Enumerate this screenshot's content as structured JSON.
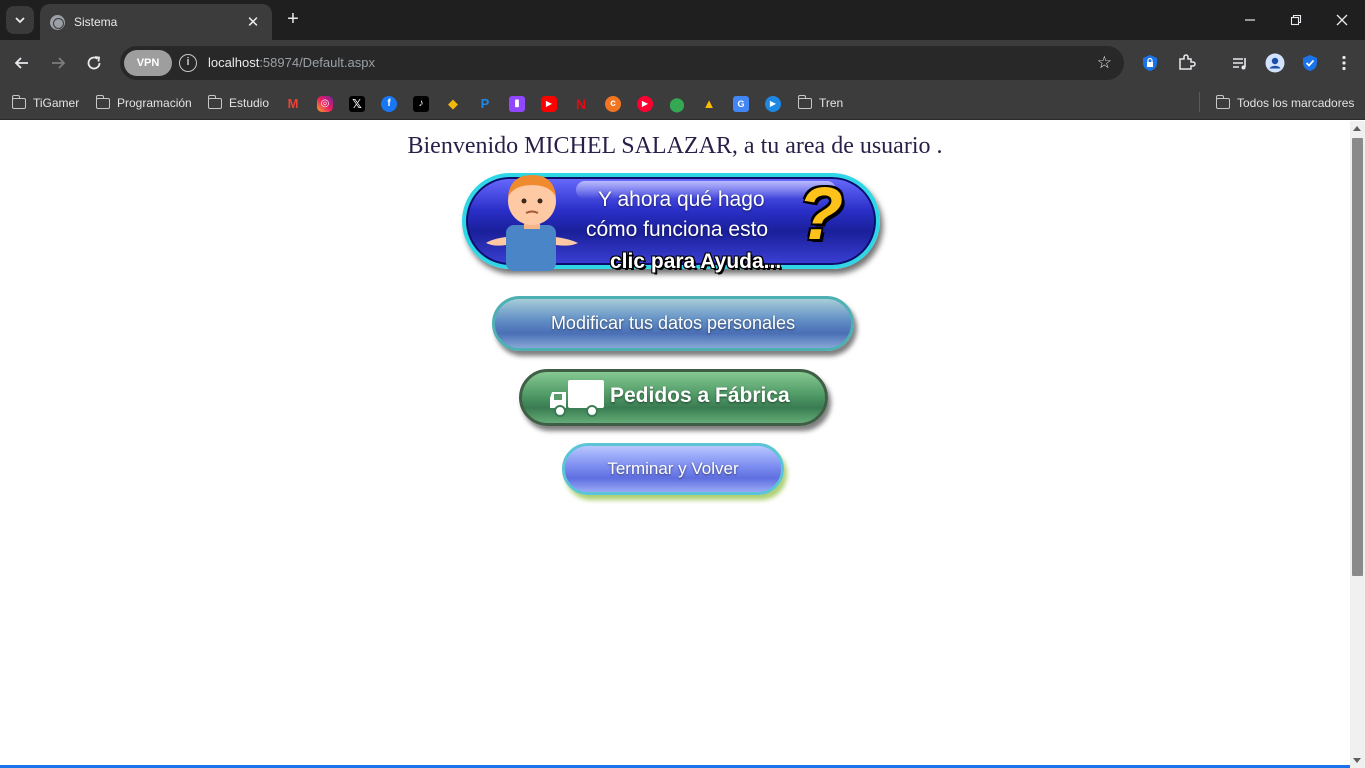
{
  "browser": {
    "tab_title": "Sistema",
    "url_host": "localhost",
    "url_rest": ":58974/Default.aspx",
    "vpn_label": "VPN"
  },
  "bookmarks": {
    "folders": [
      "TiGamer",
      "Programación",
      "Estudio",
      "Tren"
    ],
    "all_bookmarks": "Todos los marcadores"
  },
  "page": {
    "welcome": "Bienvenido MICHEL SALAZAR, a tu area de usuario .",
    "help": {
      "line1": "Y ahora qué hago",
      "line2": "cómo funciona esto",
      "line3": "clic para Ayuda..."
    },
    "modify_label": "Modificar tus datos personales",
    "orders_label": "Pedidos a Fábrica",
    "exit_label": "Terminar y Volver"
  },
  "colors": {
    "accent": "#1a73e8",
    "welcome_text": "#2a1f48",
    "help_question": "#ffc21a"
  }
}
